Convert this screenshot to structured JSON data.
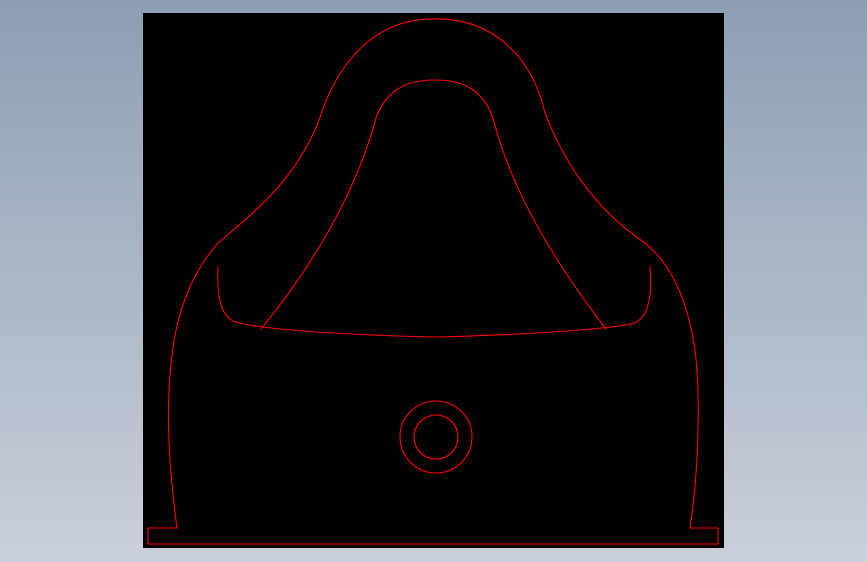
{
  "background": {
    "gradient_top": "#8e9eb3",
    "gradient_bottom": "#c9d0d9"
  },
  "viewport": {
    "background": "#000000"
  },
  "drawing": {
    "line_color": "#ff0000",
    "view": "front",
    "shape": "wall-hung urinal outline with drain hole"
  }
}
